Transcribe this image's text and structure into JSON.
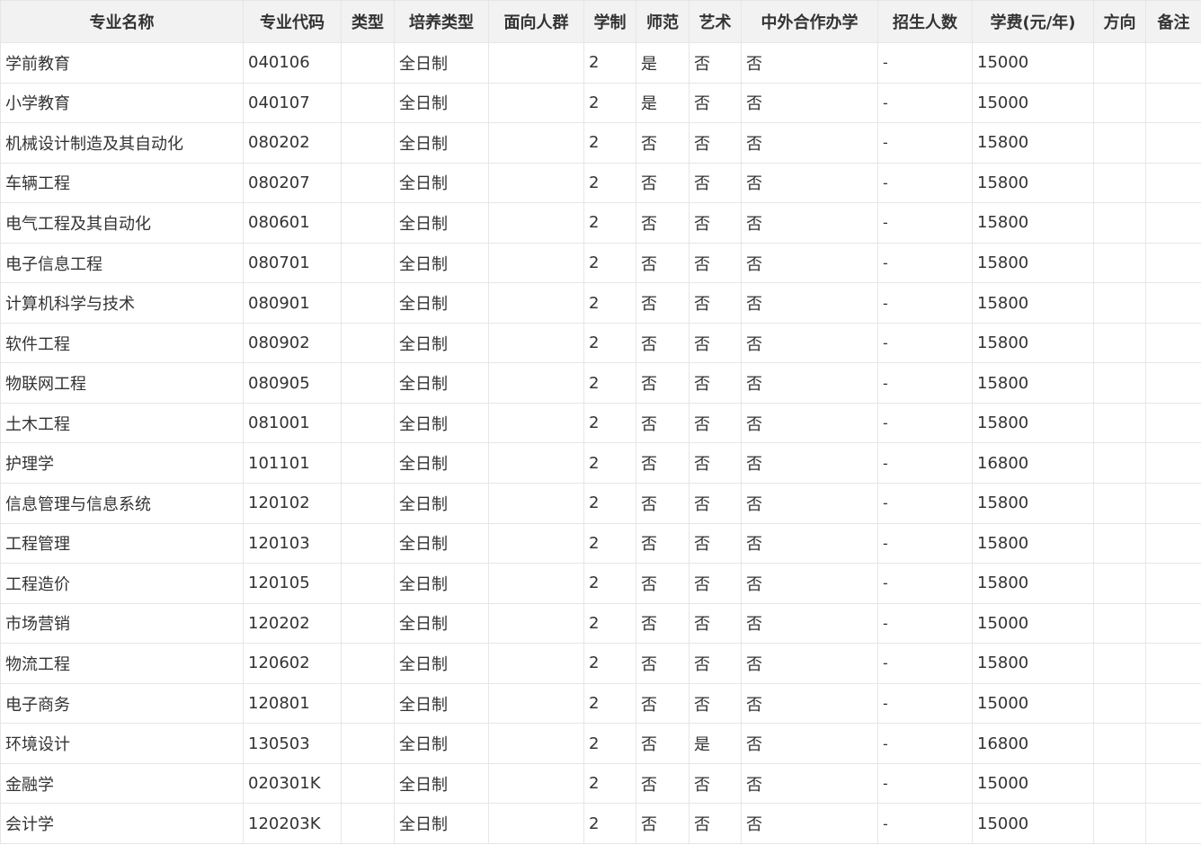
{
  "table": {
    "headers": [
      "专业名称",
      "专业代码",
      "类型",
      "培养类型",
      "面向人群",
      "学制",
      "师范",
      "艺术",
      "中外合作办学",
      "招生人数",
      "学费(元/年)",
      "方向",
      "备注"
    ],
    "rows": [
      [
        "学前教育",
        "040106",
        "",
        "全日制",
        "",
        "2",
        "是",
        "否",
        "否",
        "-",
        "15000",
        "",
        ""
      ],
      [
        "小学教育",
        "040107",
        "",
        "全日制",
        "",
        "2",
        "是",
        "否",
        "否",
        "-",
        "15000",
        "",
        ""
      ],
      [
        "机械设计制造及其自动化",
        "080202",
        "",
        "全日制",
        "",
        "2",
        "否",
        "否",
        "否",
        "-",
        "15800",
        "",
        ""
      ],
      [
        "车辆工程",
        "080207",
        "",
        "全日制",
        "",
        "2",
        "否",
        "否",
        "否",
        "-",
        "15800",
        "",
        ""
      ],
      [
        "电气工程及其自动化",
        "080601",
        "",
        "全日制",
        "",
        "2",
        "否",
        "否",
        "否",
        "-",
        "15800",
        "",
        ""
      ],
      [
        "电子信息工程",
        "080701",
        "",
        "全日制",
        "",
        "2",
        "否",
        "否",
        "否",
        "-",
        "15800",
        "",
        ""
      ],
      [
        "计算机科学与技术",
        "080901",
        "",
        "全日制",
        "",
        "2",
        "否",
        "否",
        "否",
        "-",
        "15800",
        "",
        ""
      ],
      [
        "软件工程",
        "080902",
        "",
        "全日制",
        "",
        "2",
        "否",
        "否",
        "否",
        "-",
        "15800",
        "",
        ""
      ],
      [
        "物联网工程",
        "080905",
        "",
        "全日制",
        "",
        "2",
        "否",
        "否",
        "否",
        "-",
        "15800",
        "",
        ""
      ],
      [
        "土木工程",
        "081001",
        "",
        "全日制",
        "",
        "2",
        "否",
        "否",
        "否",
        "-",
        "15800",
        "",
        ""
      ],
      [
        "护理学",
        "101101",
        "",
        "全日制",
        "",
        "2",
        "否",
        "否",
        "否",
        "-",
        "16800",
        "",
        ""
      ],
      [
        "信息管理与信息系统",
        "120102",
        "",
        "全日制",
        "",
        "2",
        "否",
        "否",
        "否",
        "-",
        "15800",
        "",
        ""
      ],
      [
        "工程管理",
        "120103",
        "",
        "全日制",
        "",
        "2",
        "否",
        "否",
        "否",
        "-",
        "15800",
        "",
        ""
      ],
      [
        "工程造价",
        "120105",
        "",
        "全日制",
        "",
        "2",
        "否",
        "否",
        "否",
        "-",
        "15800",
        "",
        ""
      ],
      [
        "市场营销",
        "120202",
        "",
        "全日制",
        "",
        "2",
        "否",
        "否",
        "否",
        "-",
        "15000",
        "",
        ""
      ],
      [
        "物流工程",
        "120602",
        "",
        "全日制",
        "",
        "2",
        "否",
        "否",
        "否",
        "-",
        "15800",
        "",
        ""
      ],
      [
        "电子商务",
        "120801",
        "",
        "全日制",
        "",
        "2",
        "否",
        "否",
        "否",
        "-",
        "15000",
        "",
        ""
      ],
      [
        "环境设计",
        "130503",
        "",
        "全日制",
        "",
        "2",
        "否",
        "是",
        "否",
        "-",
        "16800",
        "",
        ""
      ],
      [
        "金融学",
        "020301K",
        "",
        "全日制",
        "",
        "2",
        "否",
        "否",
        "否",
        "-",
        "15000",
        "",
        ""
      ],
      [
        "会计学",
        "120203K",
        "",
        "全日制",
        "",
        "2",
        "否",
        "否",
        "否",
        "-",
        "15000",
        "",
        ""
      ]
    ]
  }
}
